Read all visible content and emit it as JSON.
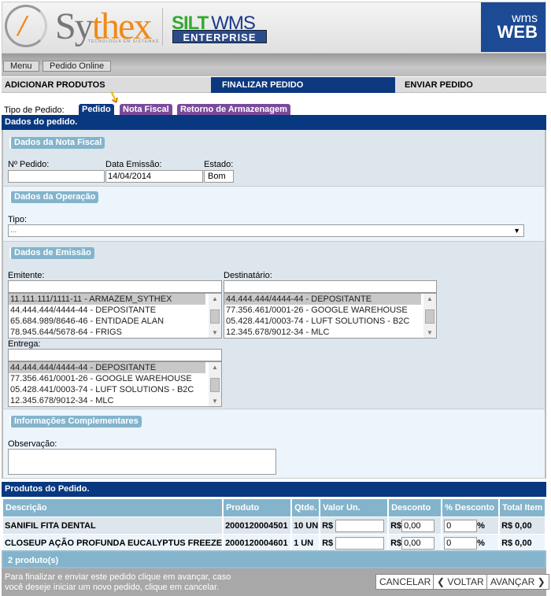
{
  "header": {
    "logo_brand": "Sythex",
    "logo_tagline": "TECNOLOGIA EM SISTEMAS",
    "product_a": "SILT",
    "product_b": "WMS",
    "product_edition": "ENTERPRISE",
    "badge_top": "wms",
    "badge_bottom": "WEB"
  },
  "breadcrumb": [
    "Menu",
    "Pedido Online"
  ],
  "steps": [
    "ADICIONAR PRODUTOS",
    "FINALIZAR PEDIDO",
    "ENVIAR PEDIDO"
  ],
  "tipo": {
    "label": "Tipo de Pedido:",
    "tabs": [
      "Pedido",
      "Nota Fiscal",
      "Retorno de Armazenagem"
    ],
    "active": "Pedido"
  },
  "dados_bar": "Dados do pedido.",
  "nota_fiscal": {
    "legend": "Dados da Nota Fiscal",
    "pedido_label": "Nº Pedido:",
    "pedido_value": "",
    "data_label": "Data Emissão:",
    "data_value": "14/04/2014",
    "estado_label": "Estado:",
    "estado_value": "Bom"
  },
  "operacao": {
    "legend": "Dados da Operação",
    "tipo_label": "Tipo:",
    "tipo_value": "..."
  },
  "emissao": {
    "legend": "Dados de Emissão",
    "emitente": {
      "label": "Emitente:",
      "filter": "",
      "options": [
        "11.111.111/1111-11 - ARMAZEM_SYTHEX",
        "44.444.444/4444-44 - DEPOSITANTE",
        "65.684.989/8646-46 - ENTIDADE ALAN",
        "78.945.644/5678-64 - FRIGS"
      ]
    },
    "destinatario": {
      "label": "Destinatário:",
      "filter": "",
      "options": [
        "44.444.444/4444-44 - DEPOSITANTE",
        "77.356.461/0001-26 - GOOGLE WAREHOUSE",
        "05.428.441/0003-74 - LUFT SOLUTIONS - B2C",
        "12.345.678/9012-34 - MLC"
      ]
    },
    "entrega": {
      "label": "Entrega:",
      "filter": "",
      "options": [
        "44.444.444/4444-44 - DEPOSITANTE",
        "77.356.461/0001-26 - GOOGLE WAREHOUSE",
        "05.428.441/0003-74 - LUFT SOLUTIONS - B2C",
        "12.345.678/9012-34 - MLC"
      ]
    }
  },
  "complementares": {
    "legend": "Informações Complementares",
    "obs_label": "Observação:",
    "obs_value": ""
  },
  "produtos": {
    "bar": "Produtos do Pedido.",
    "columns": [
      "Descrição",
      "Produto",
      "Qtde.",
      "Valor Un.",
      "Desconto",
      "% Desconto",
      "Total Item"
    ],
    "rows": [
      {
        "desc": "SANIFIL FITA DENTAL",
        "produto": "2000120004501",
        "qtde": "10 UN",
        "currency": "R$",
        "valor": "",
        "desconto": "0,00",
        "pct": "0",
        "pct_sign": "%",
        "total": "R$ 0,00"
      },
      {
        "desc": "CLOSEUP AÇÃO PROFUNDA EUCALYPTUS FREEZE",
        "produto": "2000120004601",
        "qtde": "1 UN",
        "currency": "R$",
        "valor": "",
        "desconto": "0,00",
        "pct": "0",
        "pct_sign": "%",
        "total": "R$ 0,00"
      }
    ],
    "count": "2 produto(s)"
  },
  "footer": {
    "hint": "Para finalizar e enviar este pedido clique em avançar, caso você deseje iniciar um novo pedido, clique em cancelar.",
    "cancel": "CANCELAR",
    "back": "VOLTAR",
    "next": "AVANÇAR"
  }
}
